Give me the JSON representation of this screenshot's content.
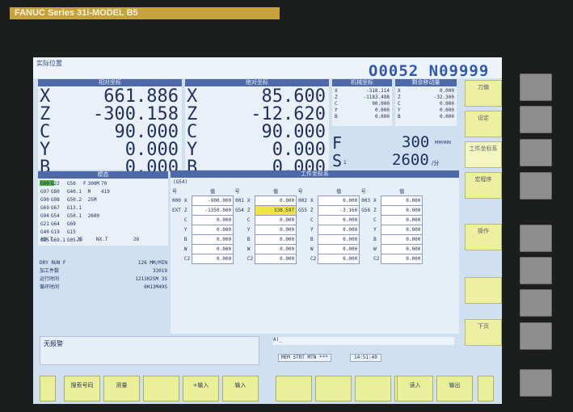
{
  "bezel": {
    "brand": "FANUC",
    "series": "Series 31",
    "model_suffix": "i-MODEL B5"
  },
  "screen": {
    "title": "实际位置",
    "program_number": "O0052 N09999"
  },
  "relative": {
    "header": "相对坐标",
    "axes": [
      {
        "name": "X",
        "value": "661.886"
      },
      {
        "name": "Z",
        "value": "-300.158"
      },
      {
        "name": "C",
        "value": "90.000"
      },
      {
        "name": "Y",
        "value": "0.000"
      },
      {
        "name": "B",
        "value": "0.000"
      }
    ]
  },
  "absolute": {
    "header": "绝对坐标",
    "axes": [
      {
        "name": "X",
        "value": "85.600"
      },
      {
        "name": "Z",
        "value": "-12.620"
      },
      {
        "name": "C",
        "value": "90.000"
      },
      {
        "name": "Y",
        "value": "0.000"
      },
      {
        "name": "B",
        "value": "0.000"
      }
    ]
  },
  "machine": {
    "header": "机械坐标",
    "axes": [
      {
        "name": "X",
        "value": "-318.114"
      },
      {
        "name": "Z",
        "value": "-1183.498"
      },
      {
        "name": "C",
        "value": "90.000"
      },
      {
        "name": "Y",
        "value": "0.000"
      },
      {
        "name": "B",
        "value": "0.000"
      }
    ]
  },
  "remaining": {
    "header": "剩余移动量",
    "axes": [
      {
        "name": "X",
        "value": "0.000"
      },
      {
        "name": "Z",
        "value": "-32.300"
      },
      {
        "name": "C",
        "value": "0.000"
      },
      {
        "name": "Y",
        "value": "0.000"
      },
      {
        "name": "B",
        "value": "0.000"
      }
    ]
  },
  "feed": {
    "label": "F",
    "value": "300",
    "unit": "MM/MIN"
  },
  "spindle": {
    "label": "S",
    "sub": "1",
    "value": "2600",
    "unit": "/分"
  },
  "modal": {
    "header": "模态",
    "rows": [
      [
        "G00",
        "G22",
        "G50",
        "F",
        "300M",
        "70"
      ],
      [
        "G97",
        "G80",
        "G40.1",
        "",
        "M",
        "419"
      ],
      [
        "G90",
        "G98",
        "G50.2",
        "",
        "25M",
        ""
      ],
      [
        "G69",
        "G67",
        "G13.1",
        "",
        "",
        ""
      ],
      [
        "G94",
        "G54",
        "G50.1",
        "",
        "2600",
        ""
      ],
      [
        "G21",
        "G64",
        "G69",
        "",
        "",
        ""
      ],
      [
        "G40",
        "G19",
        "G15",
        "",
        "",
        ""
      ],
      [
        "G25",
        "G69.1",
        "G05.5",
        "",
        "",
        ""
      ]
    ],
    "hd_label": "HD.T",
    "hd_value": "25",
    "nx_label": "NX.T",
    "nx_value": "26"
  },
  "status": {
    "run_label": "DRY RUN F",
    "run_value": "126 MM/MIN",
    "parts_label": "加工件数",
    "parts_value": "33019",
    "run_time_label": "运行时间",
    "run_time_value": "1213H25M 3S",
    "cycle_time_label": "循环时间",
    "cycle_time_value": "0H13M49S"
  },
  "wcs": {
    "header": "工件坐标系",
    "g54_label": "(G54)",
    "col_headers": [
      "号",
      "值",
      "号",
      "值",
      "号",
      "值",
      "号",
      "值"
    ],
    "groups": [
      {
        "num": "000",
        "tag": "EXT",
        "offset_code": "001",
        "offset_tag": "G54",
        "code2": "002",
        "tag2": "G55",
        "code3": "003",
        "tag3": "G56"
      }
    ],
    "rows": [
      {
        "ax": "X",
        "v1": "-900.000",
        "ax2": "X",
        "v2": "0.000",
        "ax3": "X",
        "v3": "0.000",
        "ax4": "X",
        "v4": "0.000"
      },
      {
        "ax": "Z",
        "v1": "-1350.000",
        "ax2": "Z",
        "v2": "338.597",
        "ax3": "Z",
        "v3": "-3.160",
        "ax4": "Z",
        "v4": "0.000"
      },
      {
        "ax": "C",
        "v1": "0.000",
        "ax2": "C",
        "v2": "0.000",
        "ax3": "C",
        "v3": "0.000",
        "ax4": "C",
        "v4": "0.000"
      },
      {
        "ax": "Y",
        "v1": "0.000",
        "ax2": "Y",
        "v2": "0.000",
        "ax3": "Y",
        "v3": "0.000",
        "ax4": "Y",
        "v4": "0.000"
      },
      {
        "ax": "B",
        "v1": "0.000",
        "ax2": "B",
        "v2": "0.000",
        "ax3": "B",
        "v3": "0.000",
        "ax4": "B",
        "v4": "0.000"
      },
      {
        "ax": "W",
        "v1": "0.000",
        "ax2": "W",
        "v2": "0.000",
        "ax3": "W",
        "v3": "0.000",
        "ax4": "W",
        "v4": "0.000"
      },
      {
        "ax": "C2",
        "v1": "0.000",
        "ax2": "C2",
        "v2": "0.000",
        "ax3": "C2",
        "v3": "0.000",
        "ax4": "C2",
        "v4": "0.000"
      }
    ]
  },
  "alarm": {
    "text": "无报警"
  },
  "input": {
    "prompt": "A)_",
    "mode": "MEM",
    "strt": "STRT",
    "mtn": "MTN",
    "dash": "***",
    "time": "14:51:49"
  },
  "softkeys": {
    "right": [
      "刀偏",
      "设定",
      "工件坐标系",
      "宏程序",
      "操作",
      "",
      "下页"
    ],
    "bottom": [
      "",
      "搜索号码",
      "测量",
      "",
      "+输入",
      "输入",
      "",
      "",
      "",
      "",
      "读入",
      "输出"
    ]
  }
}
